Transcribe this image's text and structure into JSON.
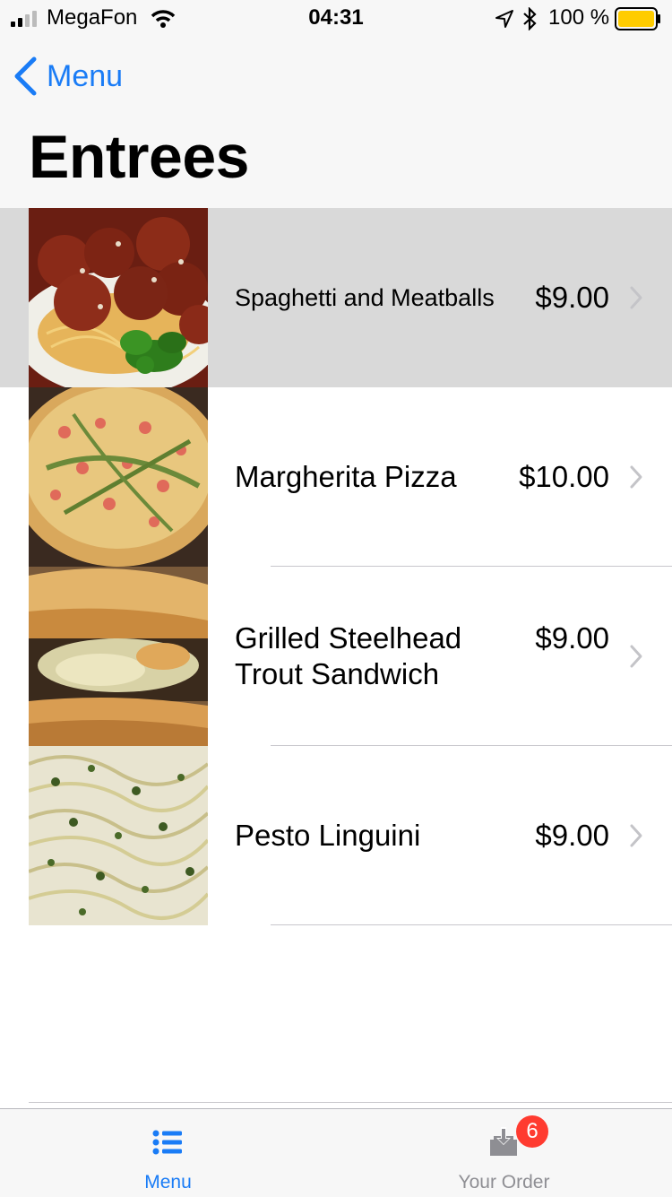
{
  "status_bar": {
    "carrier": "MegaFon",
    "time": "04:31",
    "battery_percent": "100 %",
    "battery_color": "#ffcc00"
  },
  "nav": {
    "back_label": "Menu",
    "title": "Entrees",
    "accent_color": "#1a7cf6"
  },
  "items": [
    {
      "name": "Spaghetti and Meatballs",
      "price": "$9.00",
      "image": "spaghetti-meatballs-photo",
      "selected": true
    },
    {
      "name": "Margherita Pizza",
      "price": "$10.00",
      "image": "margherita-pizza-photo",
      "selected": false
    },
    {
      "name": "Grilled Steelhead Trout Sandwich",
      "price": "$9.00",
      "image": "trout-sandwich-photo",
      "selected": false
    },
    {
      "name": "Pesto Linguini",
      "price": "$9.00",
      "image": "pesto-linguini-photo",
      "selected": false
    }
  ],
  "tab_bar": {
    "tabs": [
      {
        "label": "Menu",
        "icon": "list-icon",
        "active": true
      },
      {
        "label": "Your Order",
        "icon": "inbox-download-icon",
        "active": false,
        "badge": "6"
      }
    ],
    "active_color": "#1a7cf6",
    "inactive_color": "#8e8e93",
    "badge_color": "#ff3b30"
  }
}
